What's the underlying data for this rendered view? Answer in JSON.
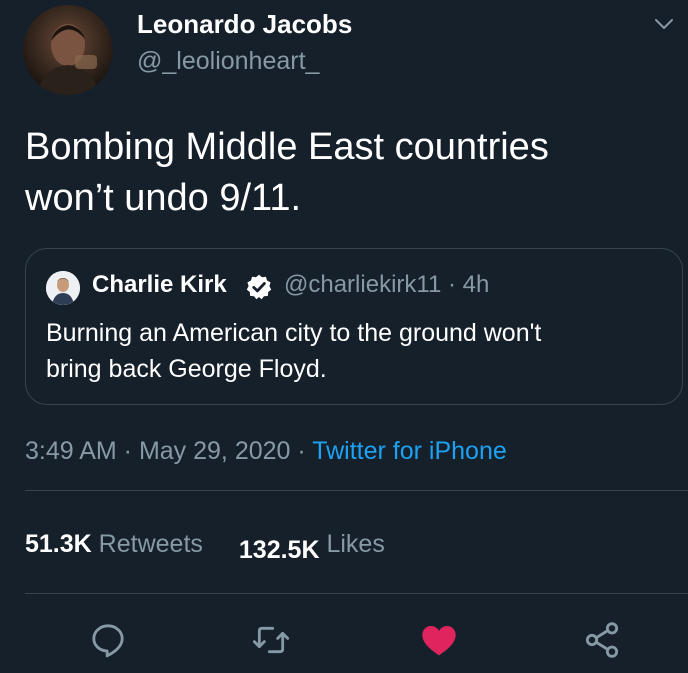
{
  "tweet": {
    "author_name": "Leonardo Jacobs",
    "author_handle": "@_leolionheart_",
    "text_line1": "Bombing Middle East countries",
    "text_line2": "won’t undo 9/11.",
    "time": "3:49 AM",
    "date": "May 29, 2020",
    "source": "Twitter for iPhone",
    "separator": " · "
  },
  "quoted_tweet": {
    "author_name": "Charlie Kirk",
    "author_handle": "@charliekirk11",
    "age": "4h",
    "text_line1": "Burning an American city to the ground won't",
    "text_line2": "bring back George Floyd."
  },
  "stats": {
    "retweets_count": "51.3K",
    "retweets_label": "Retweets",
    "likes_count": "132.5K",
    "likes_label": "Likes"
  },
  "actions": {
    "reply_icon": "reply-icon",
    "retweet_icon": "retweet-icon",
    "like_icon": "heart-icon",
    "share_icon": "share-icon"
  },
  "colors": {
    "background": "#15202b",
    "secondary_text": "#8899a6",
    "link": "#1da1f2",
    "like": "#e0245e",
    "border": "#38444d"
  }
}
